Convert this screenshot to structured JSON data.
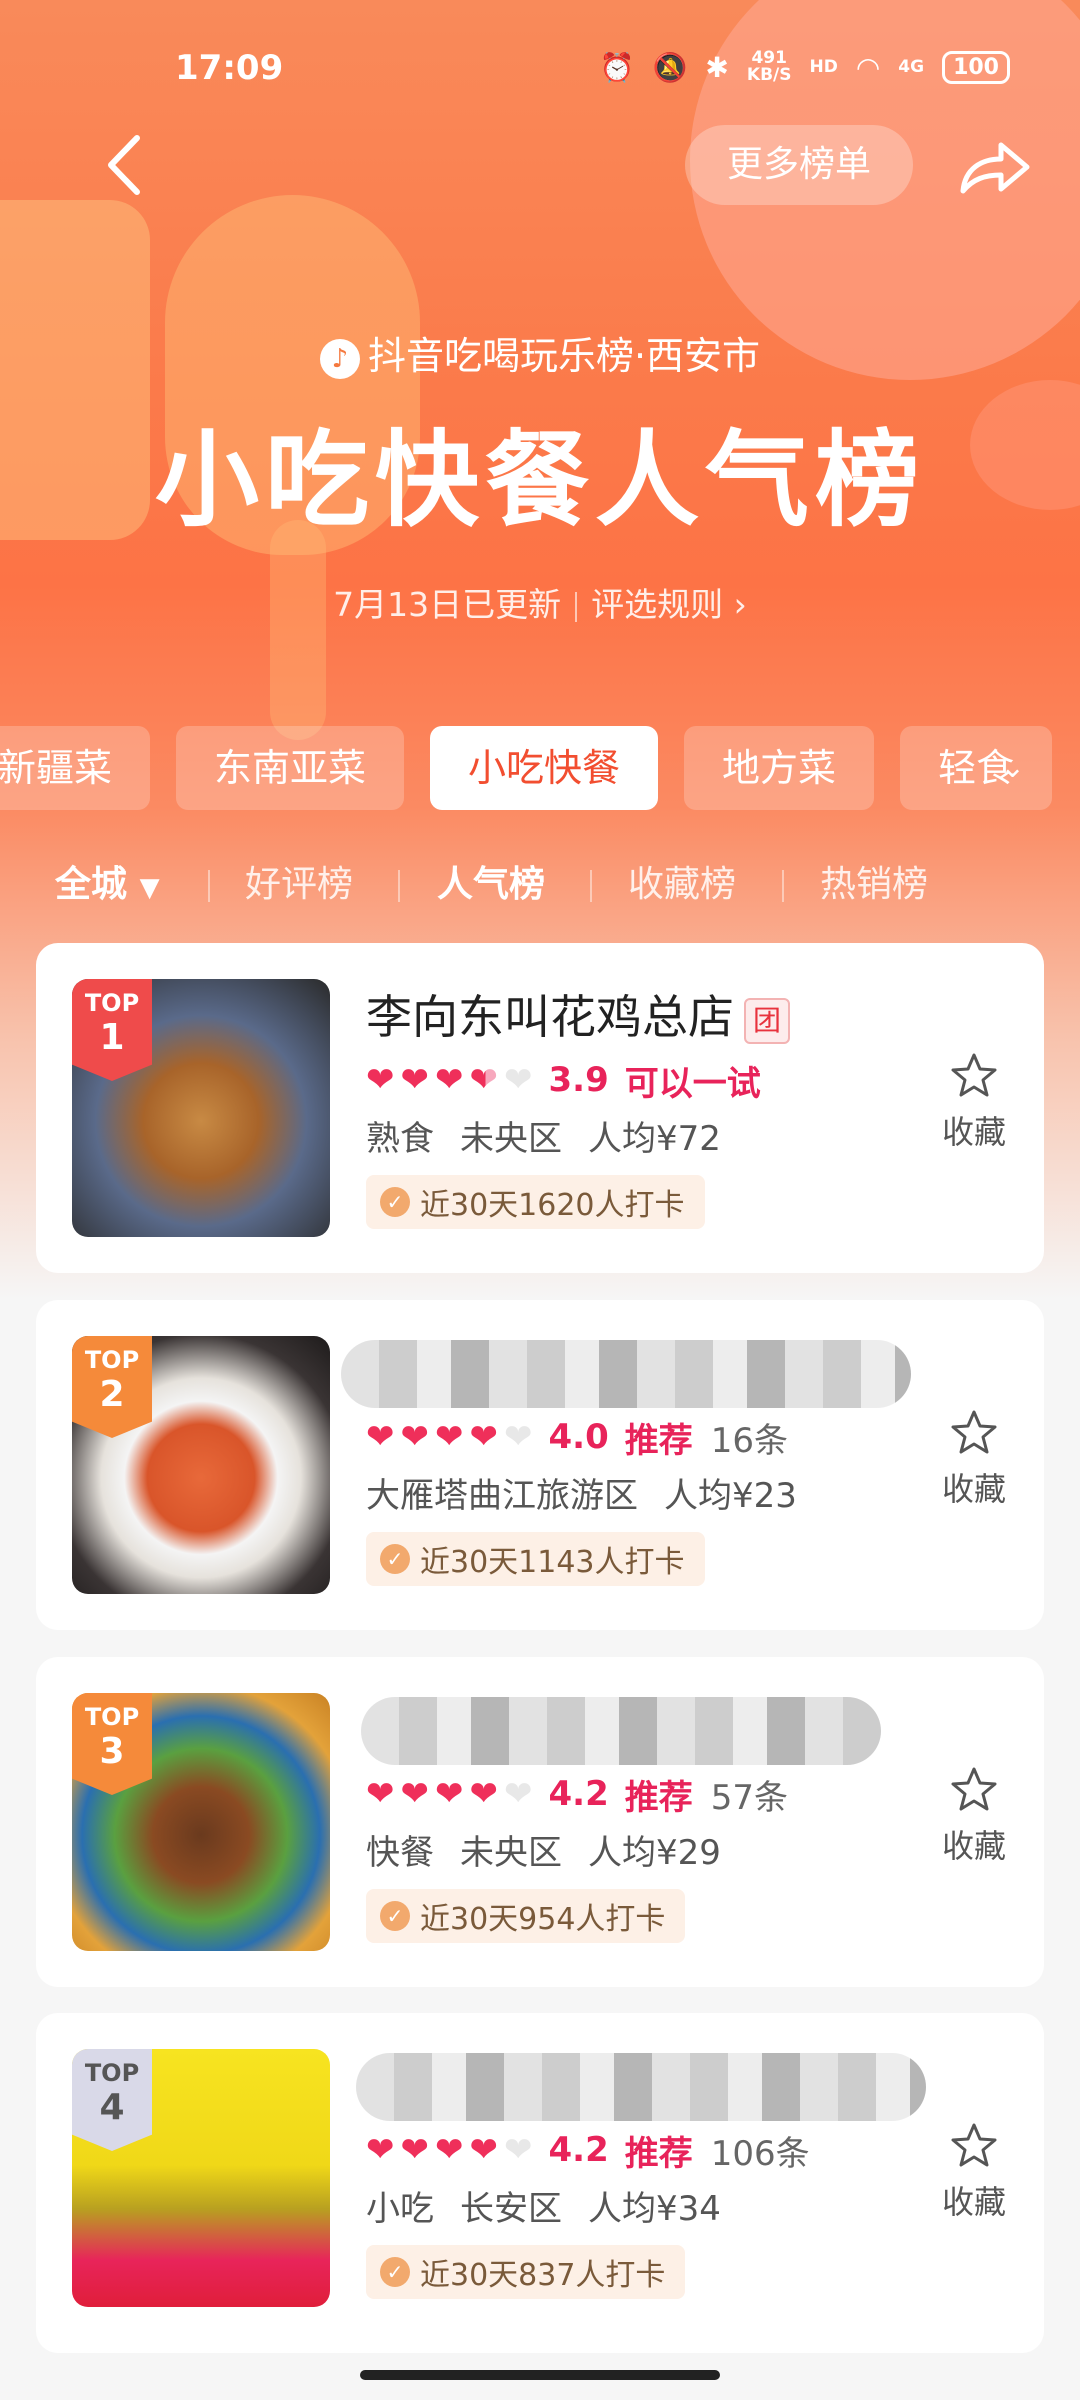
{
  "status_bar": {
    "time": "17:09",
    "net_speed_top": "491",
    "net_speed_unit": "KB/S",
    "hd": "HD",
    "sig": "4G",
    "battery": "100"
  },
  "nav": {
    "more_lists_label": "更多榜单"
  },
  "header": {
    "brand": "抖音吃喝玩乐榜·西安市",
    "title": "小吃快餐人气榜",
    "updated": "7月13日已更新",
    "rules": "评选规则"
  },
  "categories": [
    "新疆菜",
    "东南亚菜",
    "小吃快餐",
    "地方菜",
    "轻食"
  ],
  "subtabs": {
    "city": "全城",
    "good_reviews": "好评榜",
    "popular": "人气榜",
    "favorites": "收藏榜",
    "hot_sales": "热销榜"
  },
  "cards": [
    {
      "rank_label": "TOP",
      "rank": "1",
      "name": "李向东叫花鸡总店",
      "tuan": "团",
      "score": "3.9",
      "verdict": "可以一试",
      "reviews": "",
      "meta": [
        "熟食",
        "未央区",
        "人均¥72"
      ],
      "visits": "近30天1620人打卡",
      "fav_label": "收藏",
      "hearts": 3.5
    },
    {
      "rank_label": "TOP",
      "rank": "2",
      "name": "",
      "score": "4.0",
      "verdict": "推荐",
      "reviews": "16条",
      "meta": [
        "大雁塔曲江旅游区",
        "人均¥23"
      ],
      "visits": "近30天1143人打卡",
      "fav_label": "收藏",
      "hearts": 4
    },
    {
      "rank_label": "TOP",
      "rank": "3",
      "name": "",
      "score": "4.2",
      "verdict": "推荐",
      "reviews": "57条",
      "meta": [
        "快餐",
        "未央区",
        "人均¥29"
      ],
      "visits": "近30天954人打卡",
      "fav_label": "收藏",
      "hearts": 4
    },
    {
      "rank_label": "TOP",
      "rank": "4",
      "name": "",
      "score": "4.2",
      "verdict": "推荐",
      "reviews": "106条",
      "meta": [
        "小吃",
        "长安区",
        "人均¥34"
      ],
      "visits": "近30天837人打卡",
      "fav_label": "收藏",
      "hearts": 4
    }
  ],
  "colors": {
    "accent": "#f24e30",
    "rating": "#e8235a",
    "badge_red": "#ef4b4b",
    "badge_orange": "#f58a3a"
  }
}
